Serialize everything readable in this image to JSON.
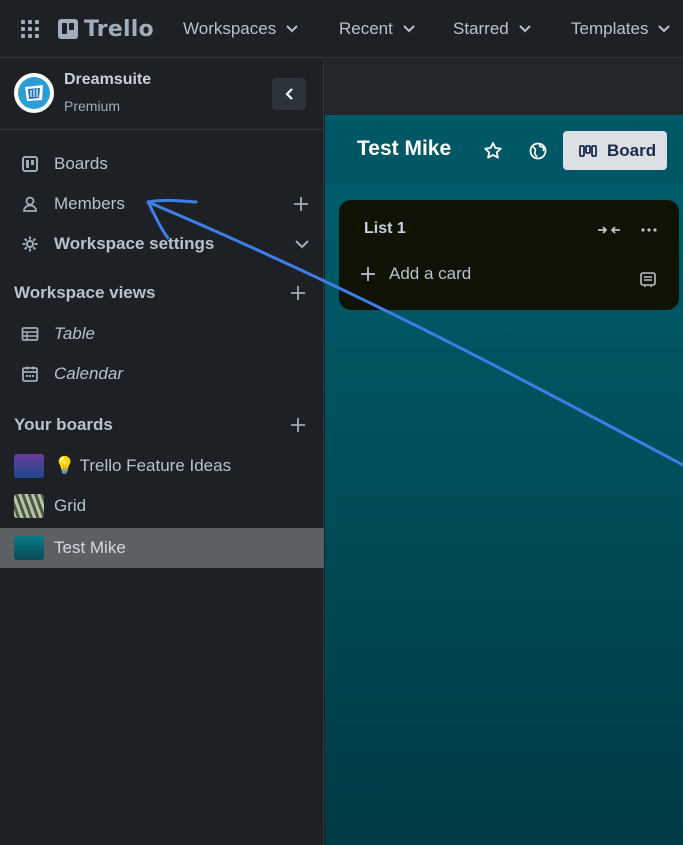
{
  "topnav": {
    "logo_text": "Trello",
    "items": [
      {
        "label": "Workspaces"
      },
      {
        "label": "Recent"
      },
      {
        "label": "Starred"
      },
      {
        "label": "Templates"
      }
    ]
  },
  "sidebar": {
    "workspace_name": "Dreamsuite",
    "workspace_plan": "Premium",
    "items": [
      {
        "label": "Boards",
        "icon": "board-icon"
      },
      {
        "label": "Members",
        "icon": "person-icon"
      },
      {
        "label": "Workspace settings",
        "icon": "gear-icon"
      }
    ],
    "views_title": "Workspace views",
    "views": [
      {
        "label": "Table",
        "icon": "table-icon"
      },
      {
        "label": "Calendar",
        "icon": "calendar-icon"
      }
    ],
    "boards_title": "Your boards",
    "boards": [
      {
        "label": "💡 Trello Feature Ideas",
        "thumb_color": "#6a3a9c"
      },
      {
        "label": "Grid",
        "thumb_color": "#7a8a70"
      },
      {
        "label": "Test Mike",
        "thumb_color": "#0a6a78",
        "active": true
      }
    ]
  },
  "board": {
    "title": "Test Mike",
    "view_button": "Board",
    "background_color": "#005f6e",
    "lists": [
      {
        "title": "List 1",
        "add_card_label": "Add a card"
      }
    ]
  },
  "annotation": {
    "type": "arrow",
    "color": "#3f7ee8",
    "points_to": "Members"
  }
}
